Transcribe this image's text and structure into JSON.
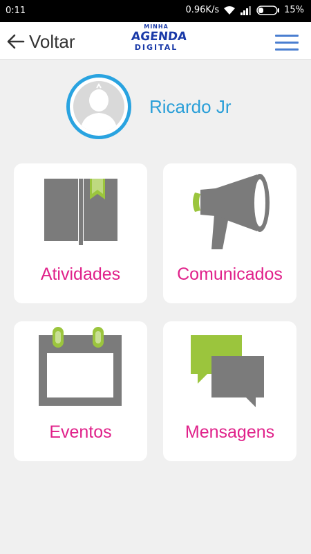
{
  "status_bar": {
    "time": "0:11",
    "network_speed": "0.96K/s",
    "battery": "15%"
  },
  "app_bar": {
    "back_label": "Voltar",
    "logo": {
      "line1": "MINHA",
      "line2": "AGENDA",
      "line3": "DIGITAL"
    }
  },
  "profile": {
    "name": "Ricardo Jr"
  },
  "menu_cards": [
    {
      "label": "Atividades",
      "icon": "book-icon"
    },
    {
      "label": "Comunicados",
      "icon": "megaphone-icon"
    },
    {
      "label": "Eventos",
      "icon": "calendar-icon"
    },
    {
      "label": "Mensagens",
      "icon": "chat-bubbles-icon"
    }
  ],
  "colors": {
    "accent_blue": "#29a3e0",
    "label_pink": "#e0218a",
    "icon_gray": "#7b7b7b",
    "icon_green": "#9bc53d",
    "menu_blue": "#4a7ed0"
  }
}
